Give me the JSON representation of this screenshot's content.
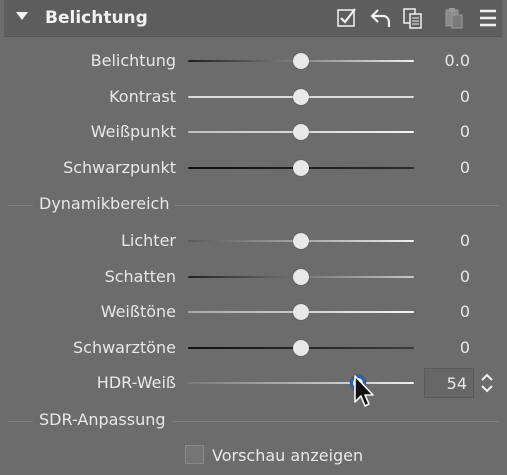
{
  "panel": {
    "title": "Belichtung",
    "icons": [
      "checkbox-checked-icon",
      "undo-icon",
      "copy-icon",
      "paste-icon",
      "menu-icon"
    ]
  },
  "sliders_main": [
    {
      "label": "Belichtung",
      "value": "0.0",
      "level": 0.5
    },
    {
      "label": "Kontrast",
      "value": "0",
      "level": 0.5
    },
    {
      "label": "Weißpunkt",
      "value": "0",
      "level": 0.5
    },
    {
      "label": "Schwarzpunkt",
      "value": "0",
      "level": 0.5
    }
  ],
  "section_dynamic": "Dynamikbereich",
  "sliders_dynamic": [
    {
      "label": "Lichter",
      "value": "0",
      "level": 0.5
    },
    {
      "label": "Schatten",
      "value": "0",
      "level": 0.5
    },
    {
      "label": "Weißtöne",
      "value": "0",
      "level": 0.5
    },
    {
      "label": "Schwarztöne",
      "value": "0",
      "level": 0.5
    }
  ],
  "hdr_white": {
    "label": "HDR-Weiß",
    "value": "54",
    "level": 0.76
  },
  "section_sdr": "SDR-Anpassung",
  "preview_checkbox": {
    "label": "Vorschau anzeigen",
    "checked": false
  },
  "colors": {
    "accent_ring": "#2f5fa8",
    "panel_bg": "#6c6c6c"
  }
}
